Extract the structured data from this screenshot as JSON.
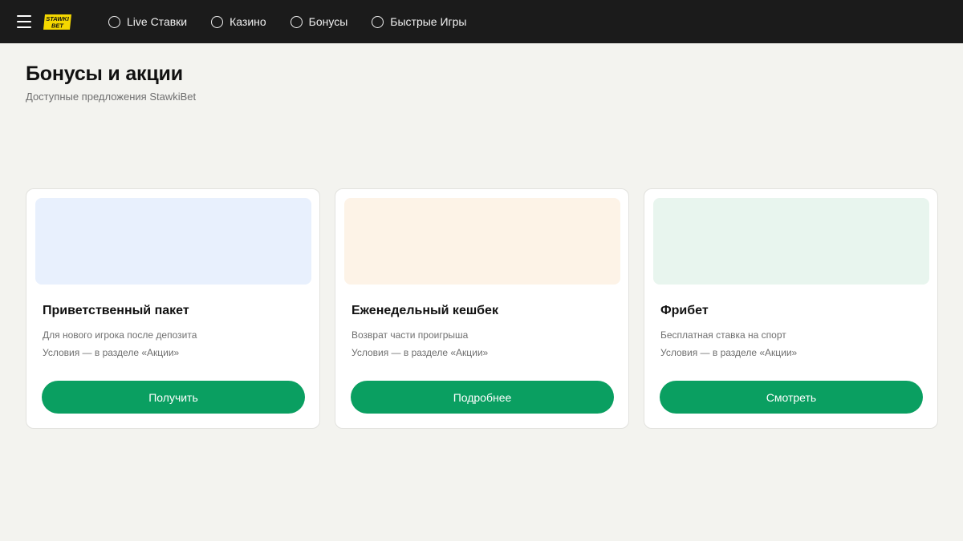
{
  "header": {
    "logo_text_top": "STAWKI",
    "logo_text_bottom": "BET",
    "menu_icon": "hamburger-menu-icon",
    "nav": [
      {
        "label": "Live Ставки",
        "icon": "circle-icon"
      },
      {
        "label": "Казино",
        "icon": "circle-icon"
      },
      {
        "label": "Бонусы",
        "icon": "circle-icon"
      },
      {
        "label": "Быстрые Игры",
        "icon": "circle-icon"
      }
    ]
  },
  "page": {
    "title": "Бонусы и акции",
    "subtitle": "Доступные предложения StawkiBet"
  },
  "cards": [
    {
      "title": "Приветственный пакет",
      "line1": "Для нового игрока после депозита",
      "line2": "Условия — в разделе «Акции»",
      "button": "Получить",
      "media_color": "#e8f0fd"
    },
    {
      "title": "Еженедельный кешбек",
      "line1": "Возврат части проигрыша",
      "line2": "Условия — в разделе «Акции»",
      "button": "Подробнее",
      "media_color": "#fdf3e7"
    },
    {
      "title": "Фрибет",
      "line1": "Бесплатная ставка на спорт",
      "line2": "Условия — в разделе «Акции»",
      "button": "Смотреть",
      "media_color": "#e8f5ee"
    }
  ],
  "colors": {
    "topbar": "#1b1b1b",
    "background": "#f3f3ef",
    "accent_green": "#0a9f61",
    "logo_yellow": "#f5d800"
  }
}
